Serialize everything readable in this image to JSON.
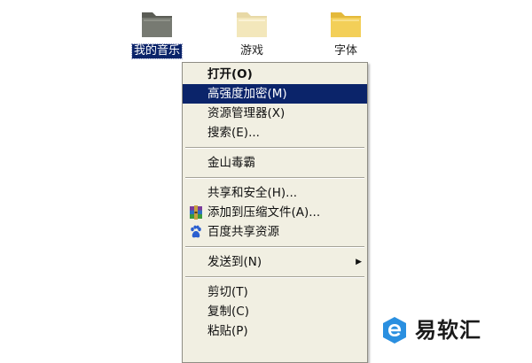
{
  "desktop": {
    "icons": [
      {
        "label": "我的音乐",
        "selected": true,
        "icon": "folder-icon"
      },
      {
        "label": "游戏",
        "selected": false,
        "icon": "folder-icon"
      },
      {
        "label": "字体",
        "selected": false,
        "icon": "folder-icon"
      }
    ]
  },
  "context_menu": {
    "items": [
      {
        "label": "打开(O)",
        "bold": true
      },
      {
        "label": "高强度加密(M)",
        "highlighted": true
      },
      {
        "label": "资源管理器(X)"
      },
      {
        "label": "搜索(E)..."
      },
      {
        "label": "金山毒霸"
      },
      {
        "label": "共享和安全(H)..."
      },
      {
        "label": "添加到压缩文件(A)...",
        "icon": "winrar-icon"
      },
      {
        "label": "百度共享资源",
        "icon": "baidu-paw-icon"
      },
      {
        "label": "发送到(N)",
        "submenu": true
      },
      {
        "label": "剪切(T)"
      },
      {
        "label": "复制(C)"
      },
      {
        "label": "粘贴(P)"
      }
    ]
  },
  "watermark": {
    "text": "易软汇"
  },
  "colors": {
    "menu_background": "#f1efe2",
    "highlight": "#0b246a",
    "brand_blue": "#2a8fe0"
  }
}
